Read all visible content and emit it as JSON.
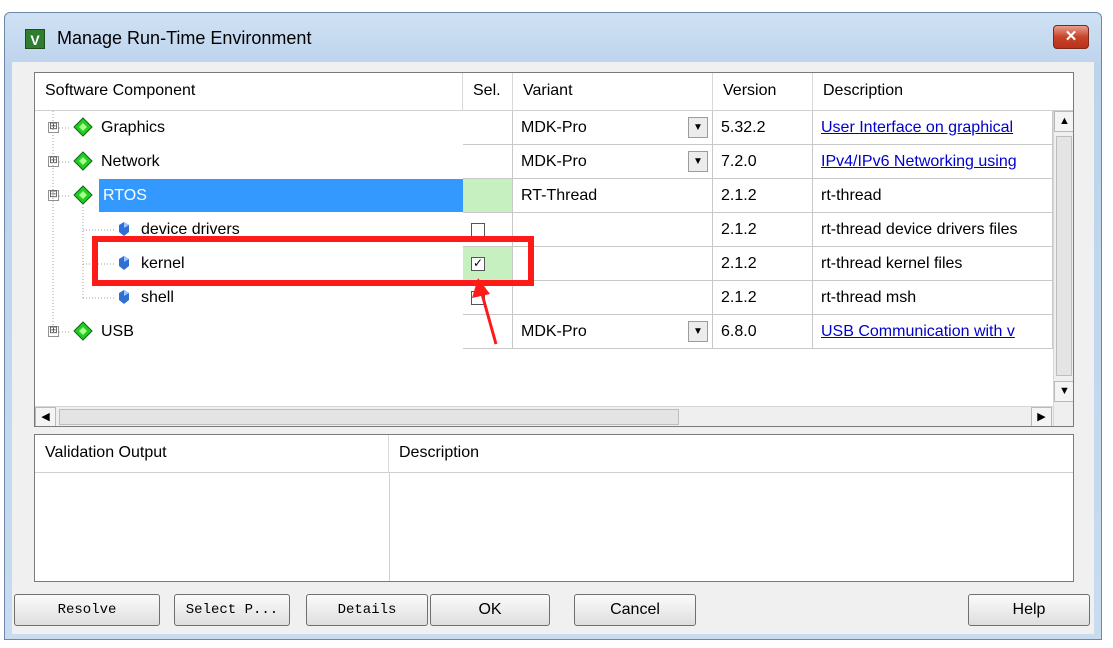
{
  "window": {
    "title": "Manage Run-Time Environment",
    "app_icon": "V",
    "close_glyph": "✕"
  },
  "grid": {
    "headers": {
      "component": "Software Component",
      "sel": "Sel.",
      "variant": "Variant",
      "version": "Version",
      "description": "Description"
    },
    "rows": [
      {
        "name": "Graphics",
        "variant": "MDK-Pro",
        "version": "5.32.2",
        "description": "User Interface on graphical"
      },
      {
        "name": "Network",
        "variant": "MDK-Pro",
        "version": "7.2.0",
        "description": "IPv4/IPv6 Networking using"
      },
      {
        "name": "RTOS",
        "variant": "RT-Thread",
        "version": "2.1.2",
        "description": "rt-thread"
      },
      {
        "name": "device drivers",
        "version": "2.1.2",
        "description": "rt-thread device drivers files"
      },
      {
        "name": "kernel",
        "version": "2.1.2",
        "description": "rt-thread kernel files",
        "check": "✓"
      },
      {
        "name": "shell",
        "version": "2.1.2",
        "description": "rt-thread msh"
      },
      {
        "name": "USB",
        "variant": "MDK-Pro",
        "version": "6.8.0",
        "description": "USB Communication with v"
      }
    ],
    "tree_plus": "⊞",
    "tree_minus": "⊟",
    "scroll_up": "▲",
    "scroll_down": "▼",
    "scroll_left": "◀",
    "scroll_right": "▶",
    "dropdown": "▼"
  },
  "validation": {
    "headers": {
      "output": "Validation Output",
      "description": "Description"
    }
  },
  "buttons": {
    "resolve": "Resolve",
    "select": "Select P...",
    "details": "Details",
    "ok": "OK",
    "cancel": "Cancel",
    "help": "Help"
  },
  "colors": {
    "annotation": "#ff1a1a",
    "selected_row": "#3399ff",
    "sel_green": "#c6f0c0",
    "link": "#0000cc"
  }
}
